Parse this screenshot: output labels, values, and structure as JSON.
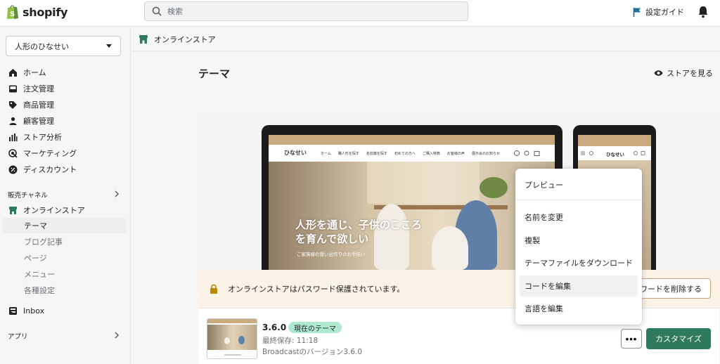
{
  "topbar": {
    "logo_text": "shopify",
    "search_placeholder": "検索",
    "setup_guide": "設定ガイド"
  },
  "sidebar": {
    "store_name": "人形のひなせい",
    "items": [
      {
        "label": "ホーム",
        "icon": "home-icon"
      },
      {
        "label": "注文管理",
        "icon": "inbox-tray-icon"
      },
      {
        "label": "商品管理",
        "icon": "tag-icon"
      },
      {
        "label": "顧客管理",
        "icon": "person-icon"
      },
      {
        "label": "ストア分析",
        "icon": "bar-chart-icon"
      },
      {
        "label": "マーケティング",
        "icon": "target-icon"
      },
      {
        "label": "ディスカウント",
        "icon": "discount-icon"
      }
    ],
    "sales_channels_label": "販売チャネル",
    "online_store": "オンラインストア",
    "sub_items": [
      "テーマ",
      "ブログ記事",
      "ページ",
      "メニュー",
      "各種設定"
    ],
    "inbox": "Inbox",
    "apps_label": "アプリ"
  },
  "breadcrumb": {
    "label": "オンラインストア"
  },
  "page": {
    "title": "テーマ",
    "view_store": "ストアを見る"
  },
  "preview": {
    "site_logo": "ひなせい",
    "site_nav": [
      "ホーム",
      "職人形を探す",
      "名前旗を探す",
      "初めての方へ",
      "ご購入特典",
      "お客様の声",
      "展示会のお知らせ"
    ],
    "hero_text": "人形を通じ、子供のこころを育んで欲しい",
    "hero_sub": "ご家族様の想い出作りのお手伝い"
  },
  "password": {
    "message": "オンラインストアはパスワード保護されています。",
    "delete_label": "ワードを削除する"
  },
  "theme": {
    "version": "3.6.0",
    "badge": "現在のテーマ",
    "saved": "最終保存: 11:18",
    "version_line": "Broadcastのバージョン3.6.0",
    "more_label": "•••",
    "customize": "カスタマイズ"
  },
  "menu": {
    "items": [
      "プレビュー",
      "名前を変更",
      "複製",
      "テーマファイルをダウンロード",
      "コードを編集",
      "言語を編集"
    ],
    "highlighted": "コードを編集"
  },
  "colors": {
    "accent_green": "#2f7a5c",
    "badge_green": "#aee9d1",
    "warning_bg": "#fdf2e6",
    "brand_green": "#95bf47"
  }
}
